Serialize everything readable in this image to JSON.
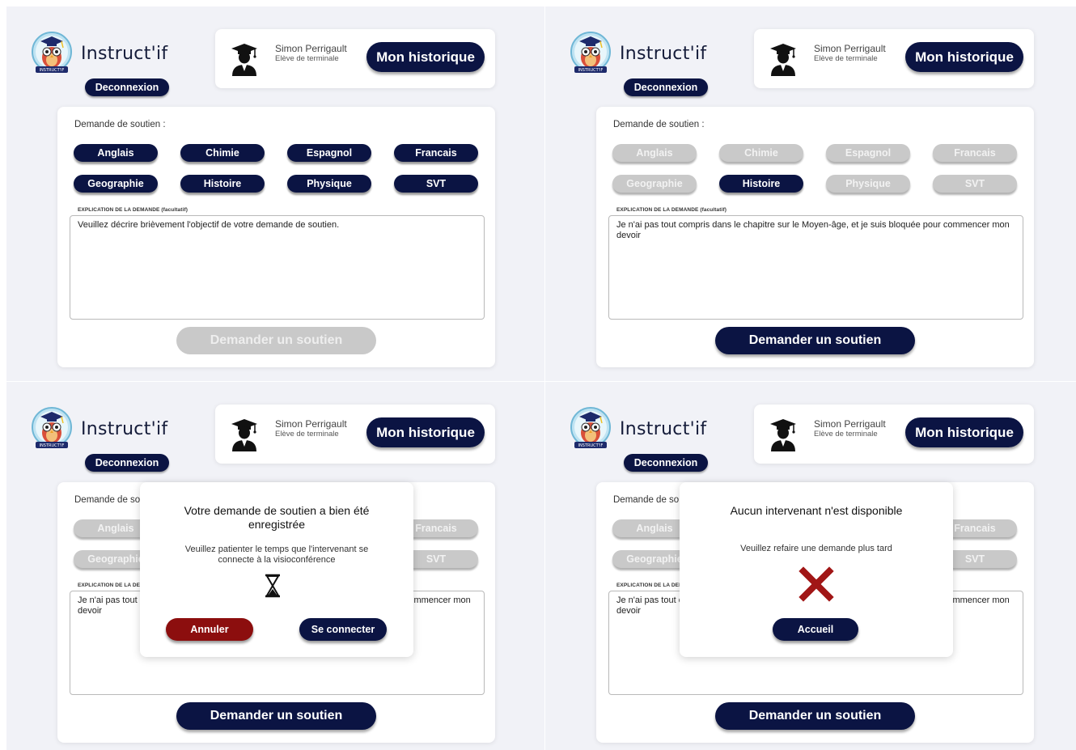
{
  "brand": "Instruct'if",
  "logo_text": "INSTRUCT'IF",
  "logout_label": "Deconnexion",
  "student": {
    "name": "Simon Perrigault",
    "level": "Elève de terminale"
  },
  "history_label": "Mon historique",
  "form": {
    "title": "Demande de soutien :",
    "explanation_label": "EXPLICATION DE LA DEMANDE (facultatif)",
    "placeholder": "Veuillez décrire brièvement l'objectif de votre demande de soutien.",
    "filled_text": "Je n'ai pas tout compris dans le chapitre sur le Moyen-âge, et je suis bloquée pour commencer mon devoir",
    "submit_label": "Demander un soutien"
  },
  "subjects": [
    "Anglais",
    "Chimie",
    "Espagnol",
    "Francais",
    "Geographie",
    "Histoire",
    "Physique",
    "SVT"
  ],
  "screens": [
    {
      "state": "initial",
      "selected": "all"
    },
    {
      "state": "subject-selected",
      "selected": "Histoire"
    },
    {
      "state": "request-registered",
      "selected": "Histoire"
    },
    {
      "state": "no-tutor",
      "selected": "Histoire"
    }
  ],
  "modal_success": {
    "title": "Votre demande de soutien a bien été enregistrée",
    "text": "Veuillez patienter le temps que l'intervenant se connecte à la visioconférence",
    "icon": "hourglass-icon",
    "cancel_label": "Annuler",
    "connect_label": "Se connecter"
  },
  "modal_error": {
    "title": "Aucun intervenant n'est disponible",
    "text": "Veuillez refaire une demande plus tard",
    "icon": "cross-icon",
    "home_label": "Accueil"
  },
  "colors": {
    "navy": "#0b1443",
    "disabled": "#c9c9c9",
    "danger": "#8c0e0e",
    "background": "#f1f2f7"
  }
}
